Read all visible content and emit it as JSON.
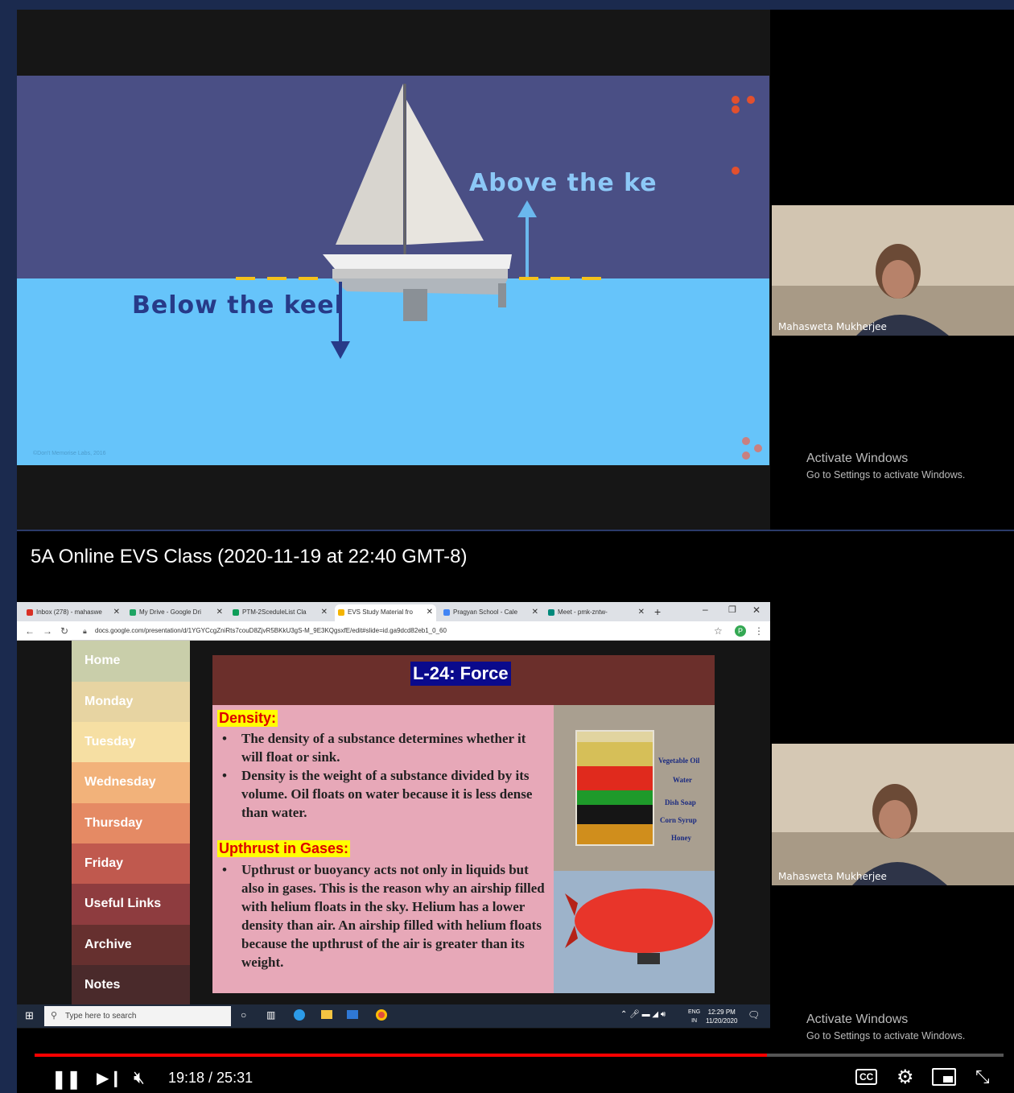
{
  "video": {
    "title": "5A Online EVS Class (2020-11-19 at 22:40 GMT-8)",
    "current_time": "19:18",
    "duration": "25:31",
    "time_display": "19:18 / 25:31",
    "progress_fraction": 0.756
  },
  "slide_top": {
    "above_label": "Above the ke",
    "below_label": "Below the keel",
    "copyright": "©Don't Memorise Labs, 2016"
  },
  "participants": [
    {
      "name": "Mahasweta Mukherjee"
    },
    {
      "name": "Mahasweta Mukherjee"
    }
  ],
  "watermark": {
    "line1": "Activate Windows",
    "line2": "Go to Settings to activate Windows."
  },
  "browser": {
    "tabs": [
      {
        "label": "Inbox (278) - mahaswe"
      },
      {
        "label": "My Drive - Google Dri"
      },
      {
        "label": "PTM-2SceduleList Cla"
      },
      {
        "label": "EVS Study Material fro"
      },
      {
        "label": "Pragyan School - Cale"
      },
      {
        "label": "Meet - pmk-zntw-"
      }
    ],
    "url": "docs.google.com/presentation/d/1YGYCcgZniRts7couD8ZjvR5BKkU3gS-M_9E3KQgsxfE/edit#slide=id.ga9dcd82eb1_0_60",
    "avatar_letter": "P"
  },
  "site_menu": [
    {
      "label": "Home",
      "color": "#c9ceaa"
    },
    {
      "label": "Monday",
      "color": "#e7d4a2"
    },
    {
      "label": "Tuesday",
      "color": "#f6dfa3"
    },
    {
      "label": "Wednesday",
      "color": "#f2b27a"
    },
    {
      "label": "Thursday",
      "color": "#e58a64"
    },
    {
      "label": "Friday",
      "color": "#c0594e"
    },
    {
      "label": "Useful Links",
      "color": "#8e3c3f"
    },
    {
      "label": "Archive",
      "color": "#66302f"
    },
    {
      "label": "Notes",
      "color": "#4a2a2b"
    }
  ],
  "lesson": {
    "title": "L-24: Force",
    "density_heading": "Density:",
    "density_points": [
      "The density of a substance determines whether it will float or sink.",
      "Density is the weight of a substance divided by its volume. Oil floats on water because it is less dense than water."
    ],
    "upthrust_heading": "Upthrust in Gases:",
    "upthrust_points": [
      "Upthrust or buoyancy acts not only in liquids but also in gases. This is the reason why an airship filled with helium floats in the sky. Helium has a lower density than air. An airship filled with helium floats because the upthrust of the air is greater than its weight."
    ],
    "layers": [
      "Vegetable Oil",
      "Water",
      "Dish Soap",
      "Corn Syrup",
      "Honey"
    ]
  },
  "taskbar": {
    "search_placeholder": "Type here to search",
    "time": "12:29 PM",
    "date": "11/20/2020",
    "lang": "ENG",
    "region": "IN"
  }
}
